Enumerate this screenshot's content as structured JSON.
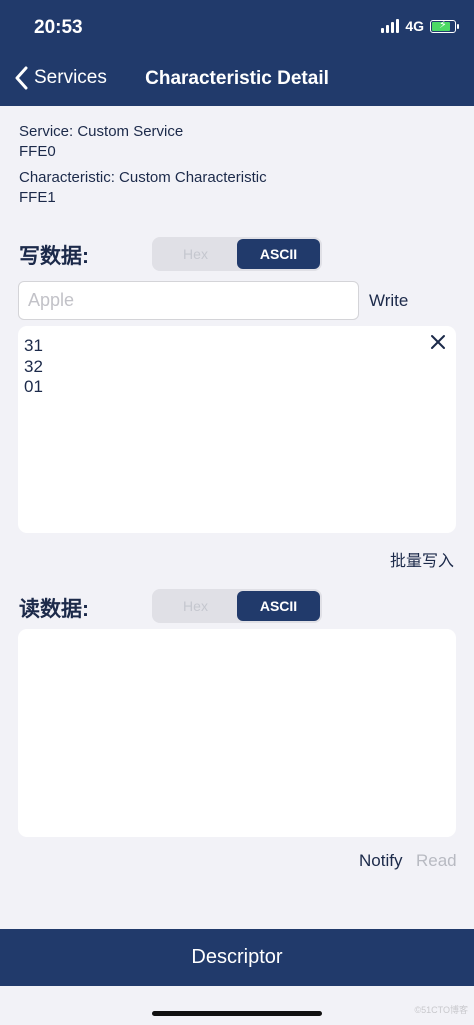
{
  "status_bar": {
    "time": "20:53",
    "network": "4G"
  },
  "nav": {
    "back_label": "Services",
    "title": "Characteristic Detail"
  },
  "info": {
    "service_line": "Service: Custom Service",
    "service_uuid": "FFE0",
    "characteristic_line": "Characteristic: Custom Characteristic",
    "characteristic_uuid": "FFE1"
  },
  "write_section": {
    "label": "写数据:",
    "format_options": [
      "Hex",
      "ASCII"
    ],
    "selected_format": "ASCII",
    "input_placeholder": "Apple",
    "input_value": "",
    "write_label": "Write",
    "log_lines": [
      "31",
      "32",
      "01"
    ],
    "batch_write_label": "批量写入"
  },
  "read_section": {
    "label": "读数据:",
    "format_options": [
      "Hex",
      "ASCII"
    ],
    "selected_format": "ASCII",
    "log_lines": [],
    "notify_label": "Notify",
    "read_label": "Read"
  },
  "footer": {
    "label": "Descriptor"
  },
  "watermark": "©51CTO博客",
  "colors": {
    "nav_bar": "#213a6b",
    "background": "#f2f2f7",
    "battery": "#4cd964"
  }
}
